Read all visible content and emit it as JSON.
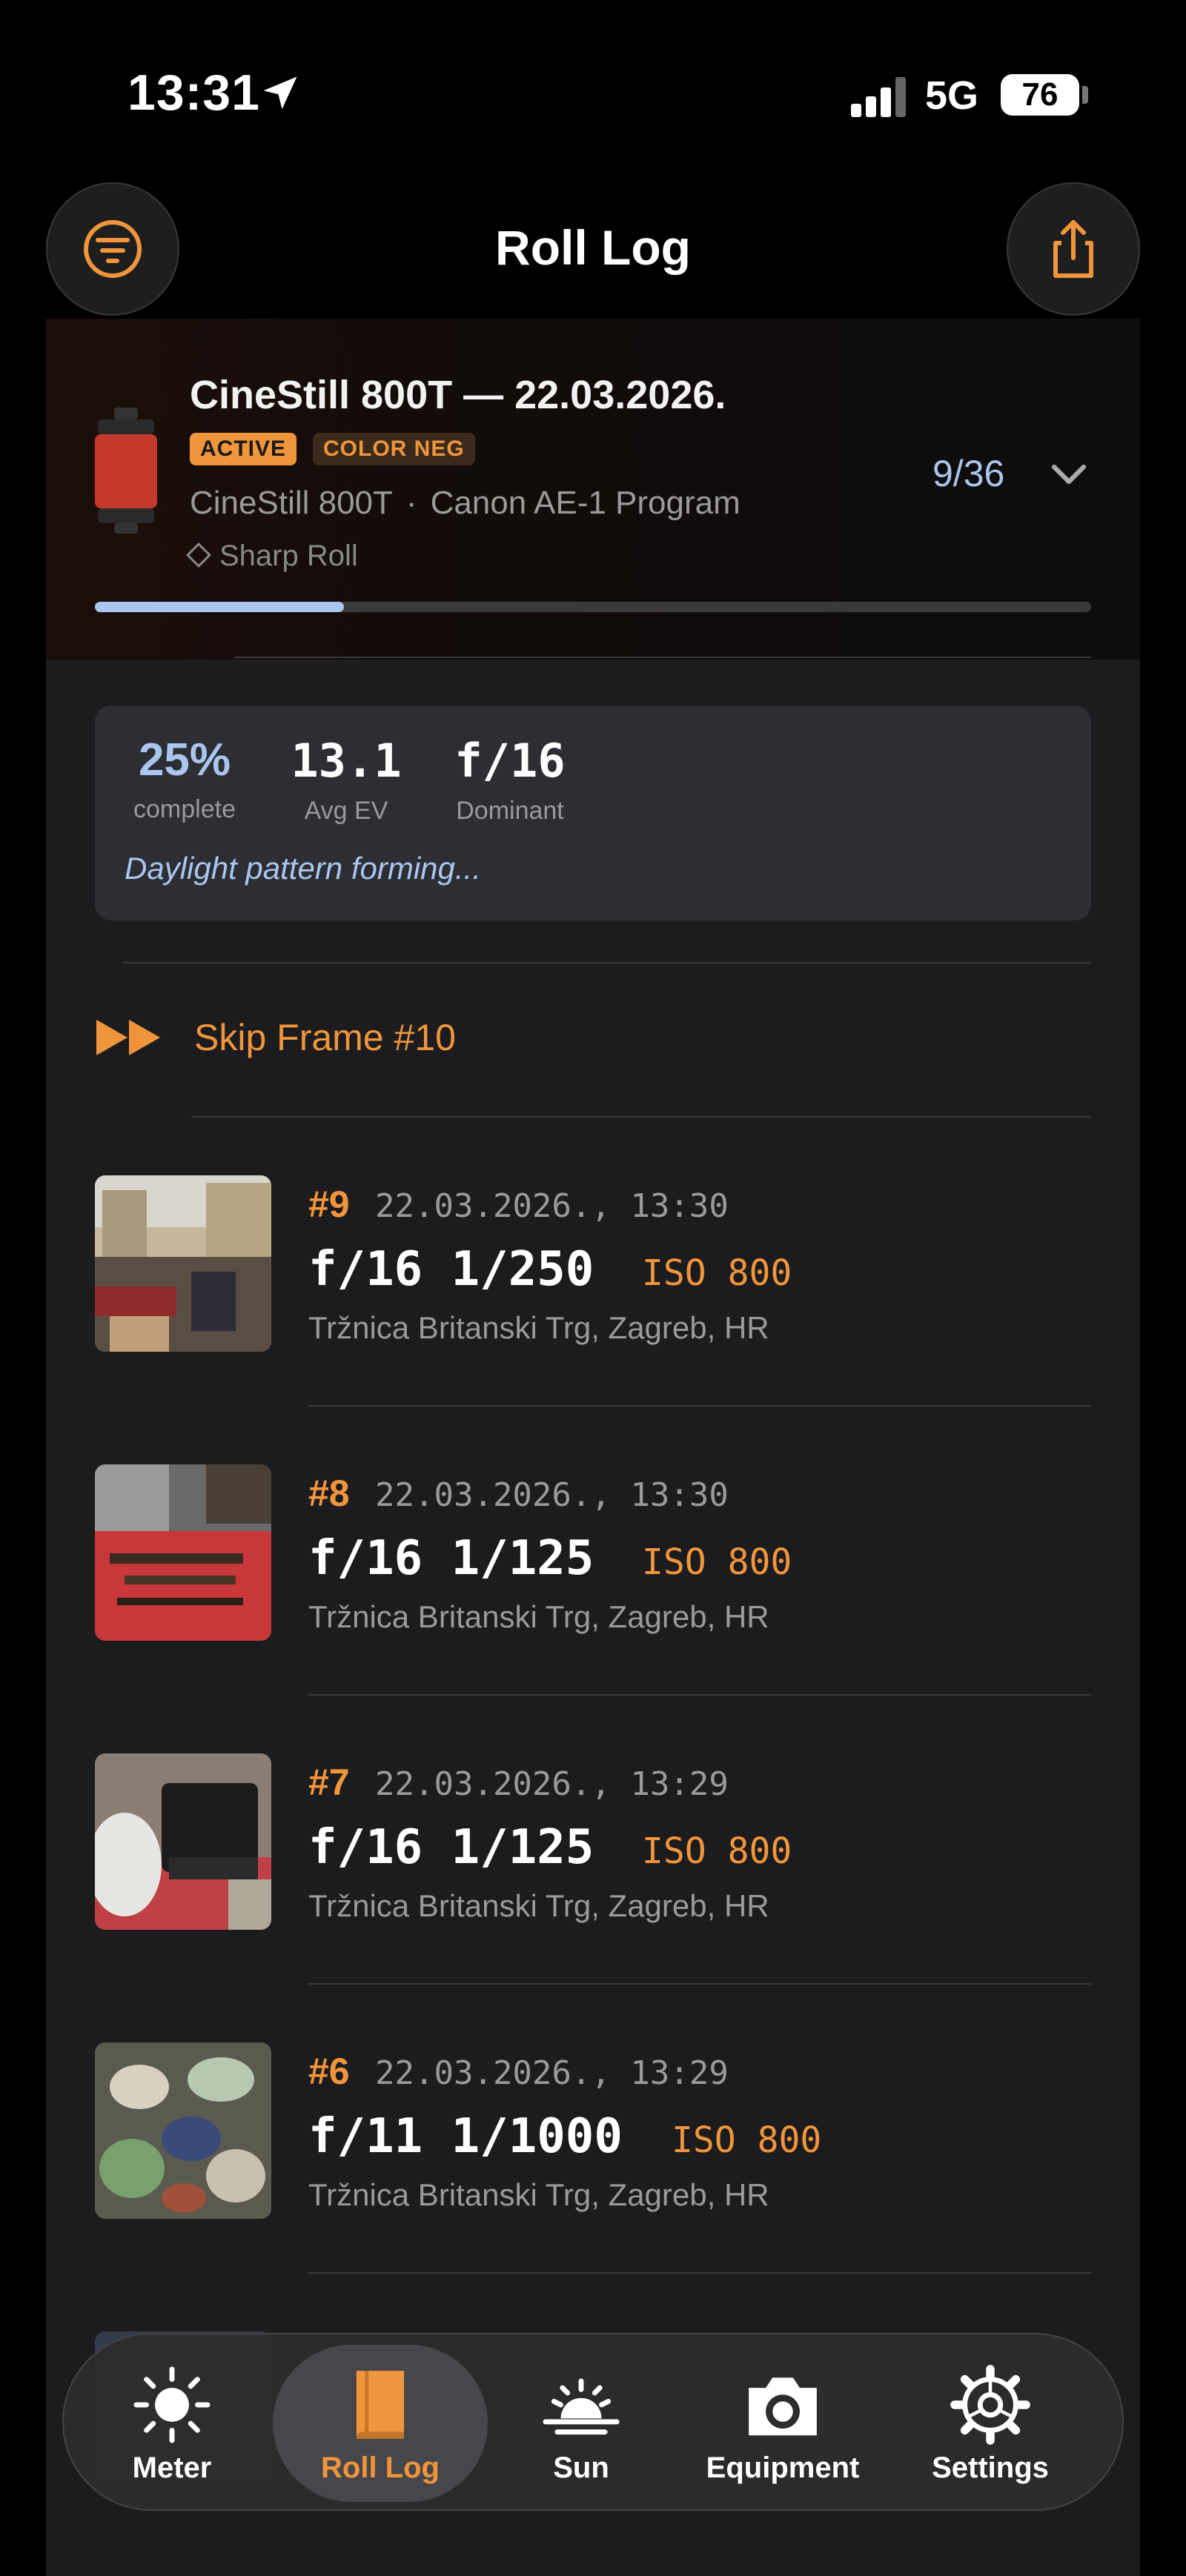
{
  "status": {
    "time": "13:31",
    "network": "5G",
    "battery": "76"
  },
  "header": {
    "title": "Roll Log",
    "filter_icon": "filter-icon",
    "share_icon": "share-icon"
  },
  "roll": {
    "title": "CineStill 800T — 22.03.2026.",
    "tags": [
      "ACTIVE",
      "COLOR NEG"
    ],
    "film": "CineStill 800T",
    "camera": "Canon AE-1 Program",
    "feature": "Sharp Roll",
    "count": "9/36",
    "progress": 0.25
  },
  "stats": {
    "complete_value": "25%",
    "complete_label": "complete",
    "ev_value": "13.1",
    "ev_label": "Avg EV",
    "aperture_value": "f/16",
    "aperture_label": "Dominant",
    "note": "Daylight pattern forming..."
  },
  "skip": {
    "label": "Skip Frame #10"
  },
  "frames": [
    {
      "num": "#9",
      "date": "22.03.2026., 13:30",
      "exposure": "f/16 1/250",
      "iso": "ISO 800",
      "location": "Tržnica Britanski Trg, Zagreb, HR"
    },
    {
      "num": "#8",
      "date": "22.03.2026., 13:30",
      "exposure": "f/16 1/125",
      "iso": "ISO 800",
      "location": "Tržnica Britanski Trg, Zagreb, HR"
    },
    {
      "num": "#7",
      "date": "22.03.2026., 13:29",
      "exposure": "f/16 1/125",
      "iso": "ISO 800",
      "location": "Tržnica Britanski Trg, Zagreb, HR"
    },
    {
      "num": "#6",
      "date": "22.03.2026., 13:29",
      "exposure": "f/11 1/1000",
      "iso": "ISO 800",
      "location": "Tržnica Britanski Trg, Zagreb, HR"
    }
  ],
  "tabs": [
    {
      "label": "Meter",
      "icon": "sun-icon"
    },
    {
      "label": "Roll Log",
      "icon": "book-icon"
    },
    {
      "label": "Sun",
      "icon": "sunset-icon"
    },
    {
      "label": "Equipment",
      "icon": "camera-icon"
    },
    {
      "label": "Settings",
      "icon": "gear-icon"
    }
  ],
  "colors": {
    "accent": "#f0953c",
    "blue": "#aac6ee",
    "background": "#1c1c1e"
  }
}
